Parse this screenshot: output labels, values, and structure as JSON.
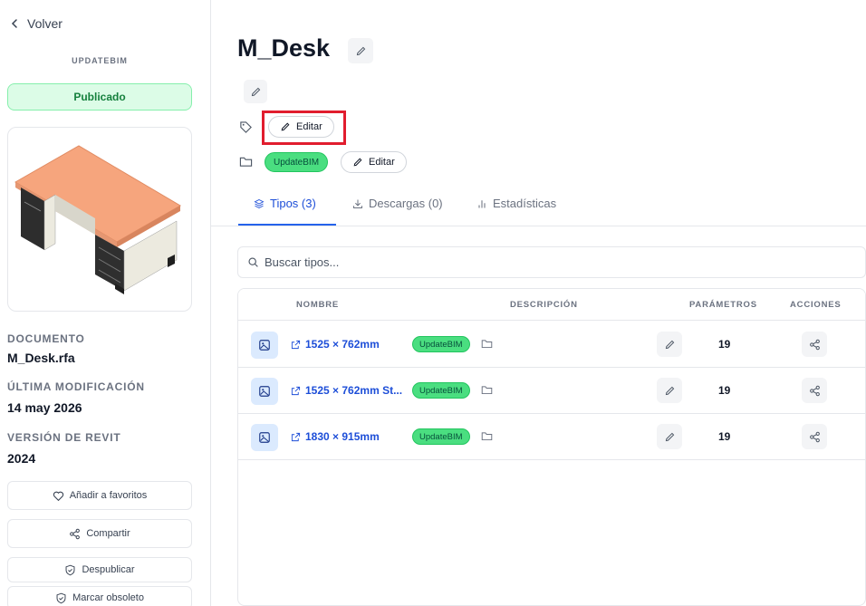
{
  "sidebar": {
    "back_label": "Volver",
    "brand": "UPDATEBIM",
    "status": "Publicado",
    "thumbnail_icon": "desk-3d-preview",
    "document_label": "DOCUMENTO",
    "document_value": "M_Desk.rfa",
    "modified_label": "ÚLTIMA MODIFICACIÓN",
    "modified_value": "14 may 2026",
    "revit_label": "VERSIÓN DE REVIT",
    "revit_value": "2024",
    "buttons": {
      "favorite": "Añadir a favoritos",
      "share": "Compartir",
      "unpublish": "Despublicar",
      "obsolete": "Marcar obsoleto"
    }
  },
  "header": {
    "title": "M_Desk",
    "tags_edit_label": "Editar",
    "folder_tag": "UpdateBIM",
    "folder_edit_label": "Editar"
  },
  "tabs": [
    {
      "label": "Tipos (3)",
      "icon": "layers-icon"
    },
    {
      "label": "Descargas (0)",
      "icon": "download-icon"
    },
    {
      "label": "Estadísticas",
      "icon": "bar-chart-icon"
    }
  ],
  "search": {
    "placeholder": "Buscar tipos..."
  },
  "table": {
    "columns": {
      "name": "NOMBRE",
      "description": "DESCRIPCIÓN",
      "parameters": "PARÁMETROS",
      "actions": "ACCIONES"
    },
    "rows": [
      {
        "name": "1525 × 762mm",
        "tag": "UpdateBIM",
        "parameters": "19"
      },
      {
        "name": "1525 × 762mm St...",
        "tag": "UpdateBIM",
        "parameters": "19"
      },
      {
        "name": "1830 × 915mm",
        "tag": "UpdateBIM",
        "parameters": "19"
      }
    ]
  },
  "colors": {
    "accent": "#2563eb",
    "published_bg": "#dcfce7",
    "tag_green": "#4ade80",
    "highlight": "#e11d2e"
  }
}
